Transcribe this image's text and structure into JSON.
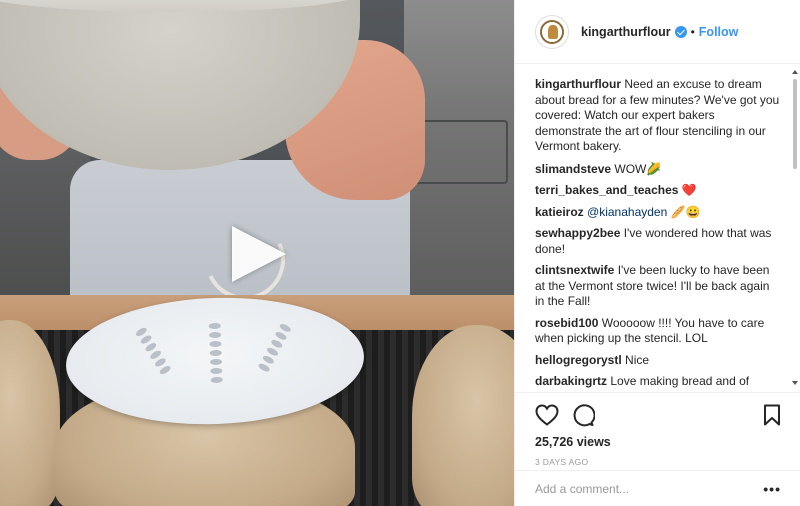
{
  "post": {
    "username": "kingarthurflour",
    "follow_label": "Follow",
    "separator": "•",
    "caption": "Need an excuse to dream about bread for a few minutes? We've got you covered: Watch our expert bakers demonstrate the art of flour stenciling in our Vermont bakery.",
    "comments": [
      {
        "user": "slimandsteve",
        "text": "WOW🌽"
      },
      {
        "user": "terri_bakes_and_teaches",
        "text": "❤️"
      },
      {
        "user": "katieiroz",
        "mention": "@kianahayden",
        "text": "🥖😀"
      },
      {
        "user": "sewhappy2bee",
        "text": "I've wondered how that was done!"
      },
      {
        "user": "clintsnextwife",
        "text": "I've been lucky to have been at the Vermont store twice! I'll be back again in the Fall!"
      },
      {
        "user": "rosebid100",
        "text": "Wooooow !!!! You have to care when picking up the stencil. LOL"
      },
      {
        "user": "hellogregorystl",
        "text": "Nice"
      },
      {
        "user": "darbakingrtz",
        "text": "Love making bread and of course eating it"
      }
    ],
    "views": "25,726 views",
    "time_ago": "3 DAYS AGO",
    "add_comment_placeholder": "Add a comment...",
    "more_label": "•••"
  },
  "icons": {
    "like": "heart-icon",
    "comment": "comment-icon",
    "save": "bookmark-icon",
    "play": "play-icon",
    "verified": "verified-badge-icon"
  },
  "colors": {
    "link_blue": "#3897f0",
    "verified_blue": "#3897f0",
    "text": "#262626",
    "muted": "#999999"
  }
}
